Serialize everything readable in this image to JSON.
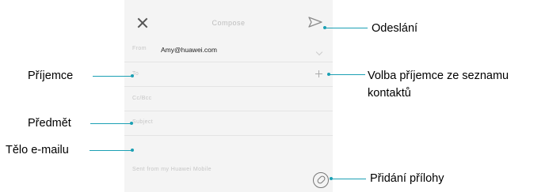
{
  "compose": {
    "title": "Compose",
    "from_label": "From",
    "from_value": "Amy@huawei.com",
    "to_label": "To",
    "cc_bcc_label": "Cc/Bcc",
    "subject_label": "Subject",
    "signature": "Sent from my Huawei Mobile"
  },
  "callouts": {
    "send": "Odeslání",
    "recipient": "Příjemce",
    "choose_recipient": "Volba příjemce ze seznamu kontaktů",
    "subject": "Předmět",
    "body": "Tělo e-mailu",
    "attach": "Přidání přílohy"
  },
  "colors": {
    "accent_line": "#1ba0b4",
    "screen_bg": "#f4f4f4"
  }
}
